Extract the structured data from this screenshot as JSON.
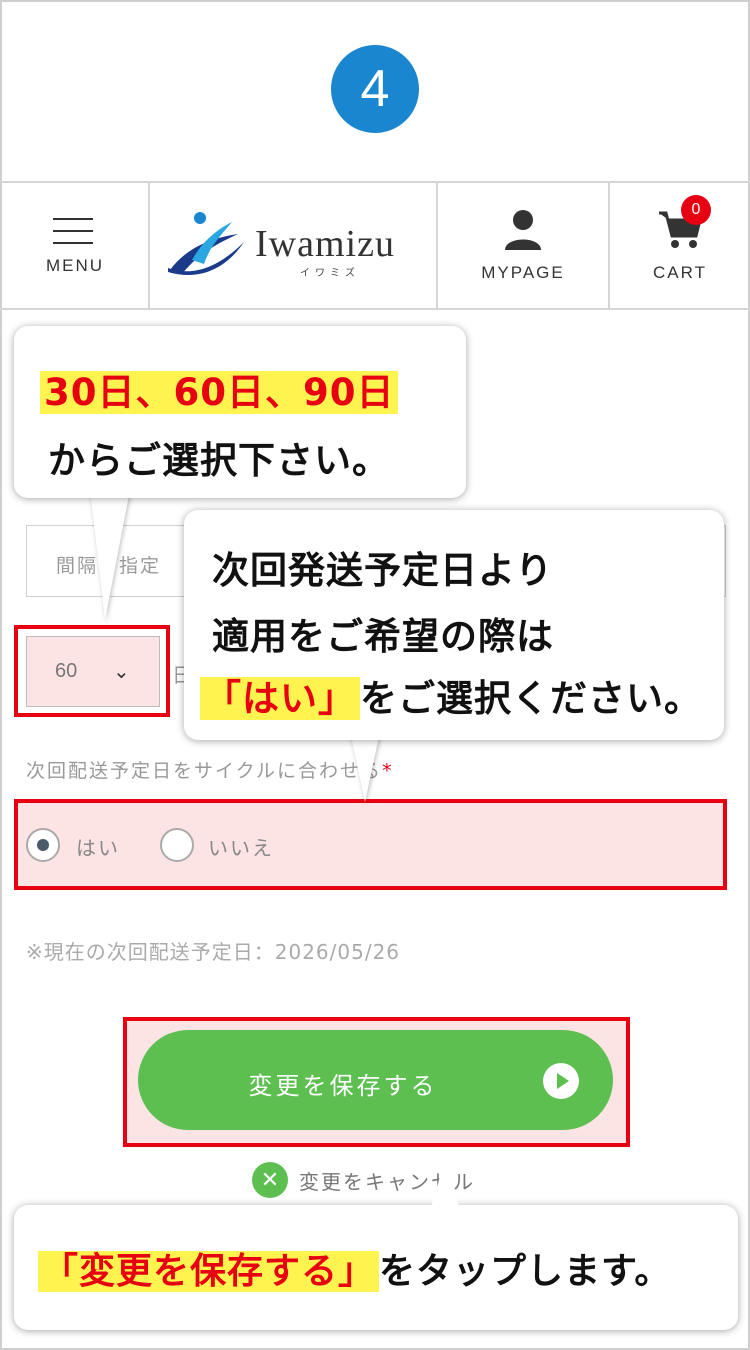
{
  "step": {
    "number": "4"
  },
  "header": {
    "menu_label": "MENU",
    "logo": {
      "text": "Iwamizu",
      "sub": "イワミズ"
    },
    "mypage_label": "MYPAGE",
    "cart_label": "CART",
    "cart_count": "0"
  },
  "form": {
    "interval_placeholder": "間隔で指定",
    "day_value": "60",
    "day_unit": "日",
    "cycle_label": "次回配送予定日をサイクルに合わせる",
    "required_mark": "*",
    "radio_yes": "はい",
    "radio_no": "いいえ",
    "radio_selected": "はい",
    "next_date": "※現在の次回配送予定日：2026/05/26",
    "save_button": "変更を保存する",
    "cancel_label": "変更をキャンセル"
  },
  "callouts": {
    "c1_highlight": "30日、60日、90日",
    "c1_line2": "からご選択下さい。",
    "c2_line1": "次回発送予定日より",
    "c2_line2": "適用をご希望の際は",
    "c2_highlight": "「はい」",
    "c2_line3_rest": "をご選択ください。",
    "c3_highlight": "「変更を保存する」",
    "c3_rest": "をタップします。"
  },
  "colors": {
    "accent_blue": "#1a86d0",
    "highlight_red": "#e60012",
    "button_green": "#5cbf50",
    "marker_yellow": "#fff44f"
  }
}
